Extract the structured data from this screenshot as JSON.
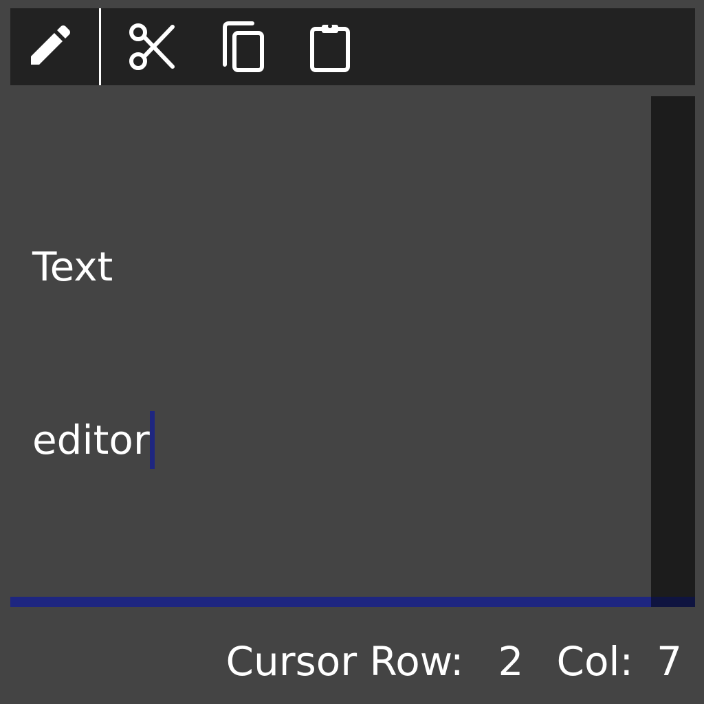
{
  "toolbar": {
    "buttons": [
      {
        "icon": "pencil-icon"
      },
      {
        "icon": "scissors-icon"
      },
      {
        "icon": "copy-icon"
      },
      {
        "icon": "clipboard-icon"
      }
    ]
  },
  "editor": {
    "lines": [
      "Text",
      "editor"
    ]
  },
  "status": {
    "row_label": "Cursor Row:",
    "row_value": "2",
    "col_label": "Col:",
    "col_value": "7"
  },
  "colors": {
    "toolbar_bg": "#222222",
    "editor_bg": "#444444",
    "accent": "#1e2680",
    "text": "#ffffff"
  }
}
